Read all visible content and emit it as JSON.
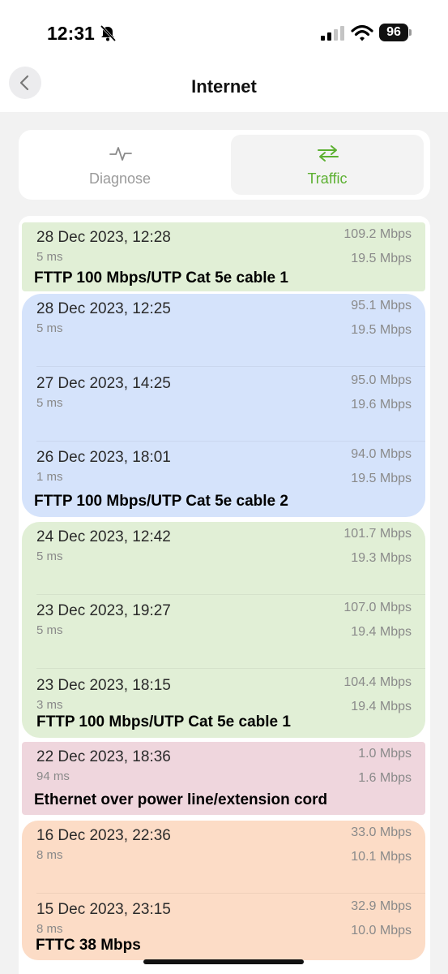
{
  "status": {
    "time": "12:31",
    "battery": "96"
  },
  "nav": {
    "title": "Internet"
  },
  "tabs": [
    {
      "label": "Diagnose",
      "active": false
    },
    {
      "label": "Traffic",
      "active": true
    }
  ],
  "colors": {
    "accent": "#5cb031",
    "green_group": "#e1efd6",
    "blue_group": "#d5e3fb",
    "pink_group": "#efd6dd",
    "orange_group": "#fcdcc6"
  },
  "results": [
    {
      "date": "28 Dec 2023, 12:28",
      "ping": "5 ms",
      "download": "109.2 Mbps",
      "upload": "19.5 Mbps"
    },
    {
      "date": "28 Dec 2023, 12:25",
      "ping": "5 ms",
      "download": "95.1 Mbps",
      "upload": "19.5 Mbps"
    },
    {
      "date": "27 Dec 2023, 14:25",
      "ping": "5 ms",
      "download": "95.0 Mbps",
      "upload": "19.6 Mbps"
    },
    {
      "date": "26 Dec 2023, 18:01",
      "ping": "1 ms",
      "download": "94.0 Mbps",
      "upload": "19.5 Mbps"
    },
    {
      "date": "24 Dec 2023, 12:42",
      "ping": "5 ms",
      "download": "101.7 Mbps",
      "upload": "19.3 Mbps"
    },
    {
      "date": "23 Dec 2023, 19:27",
      "ping": "5 ms",
      "download": "107.0 Mbps",
      "upload": "19.4 Mbps"
    },
    {
      "date": "23 Dec 2023, 18:15",
      "ping": "3 ms",
      "download": "104.4 Mbps",
      "upload": "19.4 Mbps"
    },
    {
      "date": "22 Dec 2023, 18:36",
      "ping": "94 ms",
      "download": "1.0 Mbps",
      "upload": "1.6 Mbps"
    },
    {
      "date": "16 Dec 2023, 22:36",
      "ping": "8 ms",
      "download": "33.0 Mbps",
      "upload": "10.1 Mbps"
    },
    {
      "date": "15 Dec 2023, 23:15",
      "ping": "8 ms",
      "download": "32.9 Mbps",
      "upload": "10.0 Mbps"
    }
  ],
  "annotations": [
    "FTTP 100 Mbps/UTP Cat 5e cable 1",
    "FTTP 100 Mbps/UTP Cat 5e cable 2",
    "FTTP 100 Mbps/UTP Cat 5e cable 1",
    "Ethernet over power line/extension cord",
    "FTTC 38 Mbps"
  ]
}
